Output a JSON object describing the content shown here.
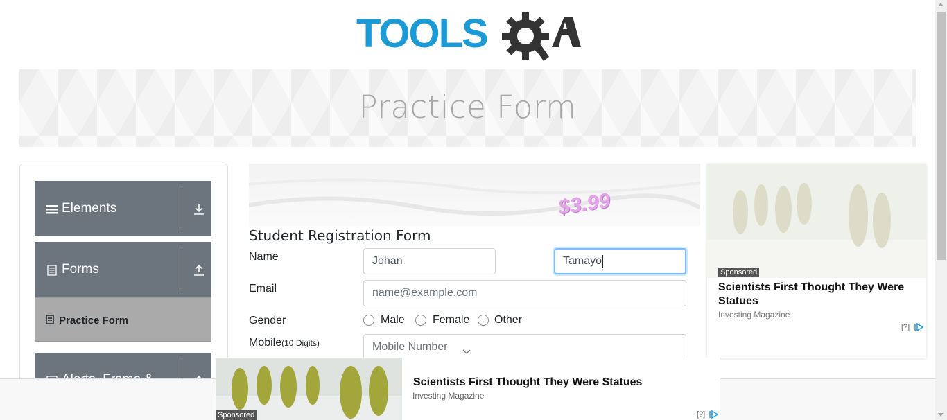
{
  "header": {
    "logo_text": "TOOLSQA"
  },
  "banner": {
    "title": "Practice Form"
  },
  "sidebar": {
    "groups": [
      {
        "label": "Elements",
        "icon": "hamburger-icon",
        "arrow": "download-arrow-icon"
      },
      {
        "label": "Forms",
        "icon": "document-icon",
        "arrow": "upload-arrow-icon"
      },
      {
        "label": "Alerts, Frame &",
        "icon": "window-icon",
        "arrow": "upload-arrow-icon"
      }
    ],
    "active_item": {
      "label": "Practice Form",
      "icon": "form-icon"
    }
  },
  "center_ad": {
    "price": "$3.99"
  },
  "form": {
    "title": "Student Registration Form",
    "name_label": "Name",
    "first_name_value": "Johan",
    "last_name_value": "Tamayo",
    "email_label": "Email",
    "email_placeholder": "name@example.com",
    "gender_label": "Gender",
    "gender_options": [
      "Male",
      "Female",
      "Other"
    ],
    "mobile_label": "Mobile",
    "mobile_hint": "(10 Digits)",
    "mobile_placeholder": "Mobile Number"
  },
  "right_ad": {
    "badge": "Sponsored",
    "headline": "Scientists First Thought They Were Statues",
    "source": "Investing Magazine",
    "info": "[?]"
  },
  "bottom_ad": {
    "badge": "Sponsored",
    "headline": "Scientists First Thought They Were Statues",
    "source": "Investing Magazine",
    "info": "[?]"
  },
  "colors": {
    "logo_blue": "#1b9ad6",
    "logo_dark": "#333333",
    "sidebar_bg": "#6c757d",
    "active_bg": "#aaaaaa",
    "focus_border": "#80bdff"
  }
}
